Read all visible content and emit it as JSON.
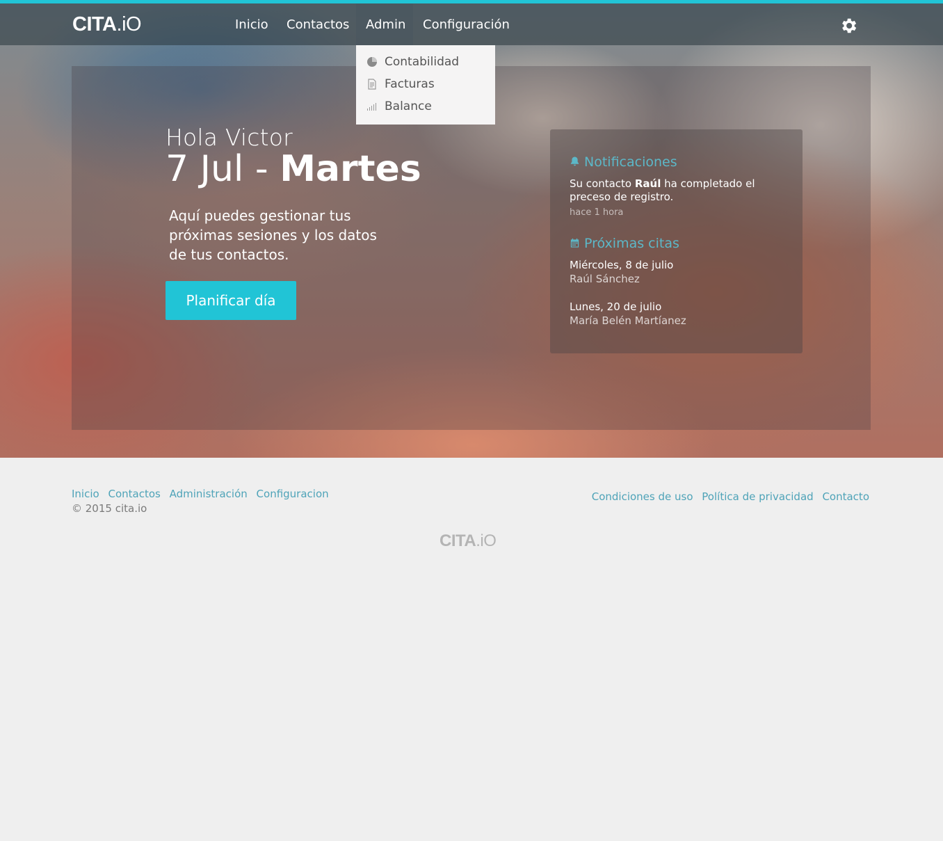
{
  "brand": {
    "logo_bold": "CITA",
    "logo_light": ".iO"
  },
  "nav": {
    "items": [
      {
        "label": "Inicio"
      },
      {
        "label": "Contactos"
      },
      {
        "label": "Admin"
      },
      {
        "label": "Configuración"
      }
    ],
    "active": "Admin"
  },
  "dropdown": {
    "items": [
      {
        "label": "Contabilidad",
        "icon": "pie-chart-icon"
      },
      {
        "label": "Facturas",
        "icon": "document-icon"
      },
      {
        "label": "Balance",
        "icon": "bar-chart-icon"
      }
    ]
  },
  "hero": {
    "greeting": "Hola Victor",
    "date_light": "7 Jul - ",
    "date_bold": "Martes",
    "intro": "Aquí puedes gestionar tus próximas sesiones y los datos de tus contactos.",
    "cta": "Planificar día"
  },
  "notifications": {
    "heading": "Notificaciones",
    "text_before": "Su contacto ",
    "text_name": "Raúl",
    "text_after": " ha completado el preceso de registro.",
    "time": "hace 1 hora"
  },
  "appointments": {
    "heading": "Próximas citas",
    "items": [
      {
        "date": "Miércoles, 8 de julio",
        "name": "Raúl Sánchez"
      },
      {
        "date": "Lunes, 20 de julio",
        "name": "María Belén Martíanez"
      }
    ]
  },
  "footer": {
    "links": [
      "Inicio",
      "Contactos",
      "Administración",
      "Configuracion"
    ],
    "copyright": "© 2015 cita.io",
    "legal": [
      "Condiciones de uso",
      "Política de privacidad",
      "Contacto"
    ],
    "logo_bold": "CITA",
    "logo_light": ".iO"
  },
  "colors": {
    "accent": "#21c4d6",
    "link": "#4ea3b8",
    "heading": "#5cb8c8"
  }
}
